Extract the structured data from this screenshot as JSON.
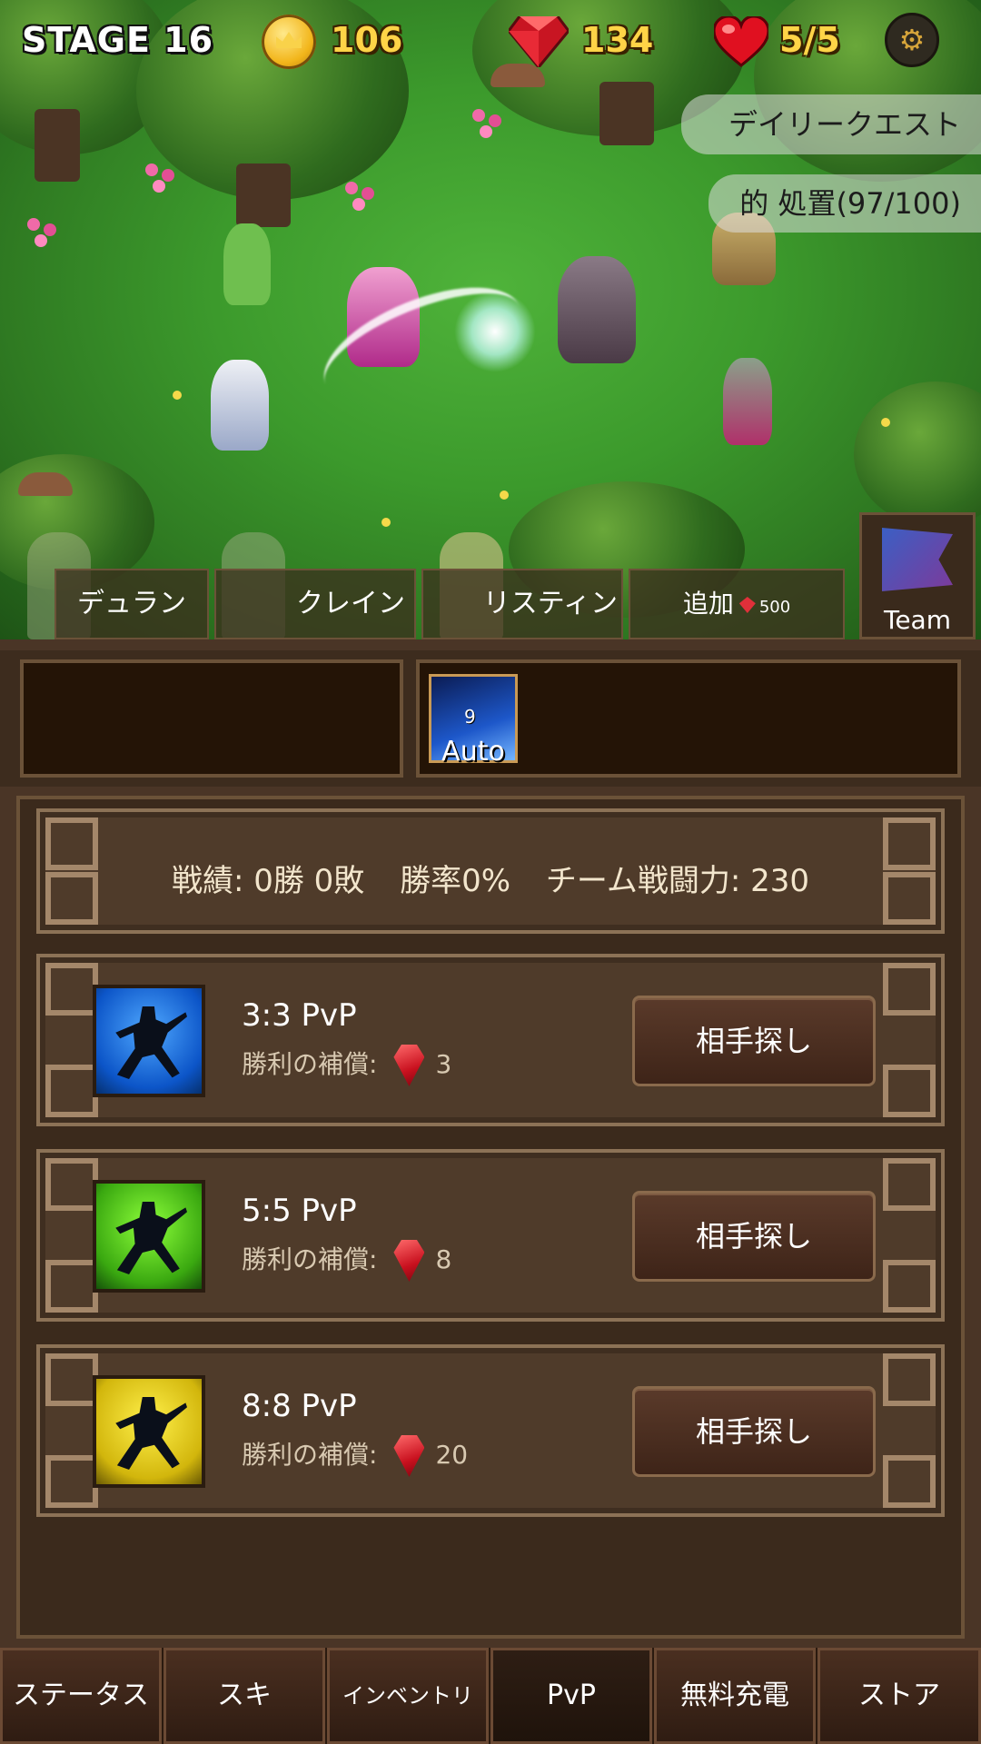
{
  "hud": {
    "stage_label": "STAGE",
    "stage_number": "16",
    "gold": "106",
    "gems": "134",
    "lives": "5/5",
    "settings_icon": "gear-icon"
  },
  "daily_quest": {
    "title": "デイリークエスト",
    "progress": "的 処置(97/100)"
  },
  "heroes": {
    "tabs": [
      {
        "name": "デュラン"
      },
      {
        "name": "クレイン"
      },
      {
        "name": "リスティン"
      }
    ],
    "add_label": "追加",
    "add_cost": "500",
    "team_label": "Team"
  },
  "skill": {
    "level": "9",
    "mode": "Auto"
  },
  "stats": {
    "record": "戦績: 0勝 0敗",
    "win_rate": "勝率0%",
    "team_power": "チーム戦闘力: 230"
  },
  "pvp_modes": [
    {
      "title": "3:3 PvP",
      "reward_label": "勝利の補償:",
      "reward": "3",
      "button": "相手探し",
      "color": "#1a6ee0"
    },
    {
      "title": "5:5 PvP",
      "reward_label": "勝利の補償:",
      "reward": "8",
      "button": "相手探し",
      "color": "#4cc21a"
    },
    {
      "title": "8:8 PvP",
      "reward_label": "勝利の補償:",
      "reward": "20",
      "button": "相手探し",
      "color": "#e3cc12"
    }
  ],
  "nav": {
    "tabs": [
      {
        "label": "ステータス"
      },
      {
        "label": "スキ"
      },
      {
        "label": "インベントリ"
      },
      {
        "label": "PvP",
        "active": true
      },
      {
        "label": "無料充電"
      },
      {
        "label": "ストア"
      }
    ]
  },
  "colors": {
    "gold_text": "#ffd447",
    "panel_bg": "#4a3526",
    "border": "#8c7256"
  }
}
